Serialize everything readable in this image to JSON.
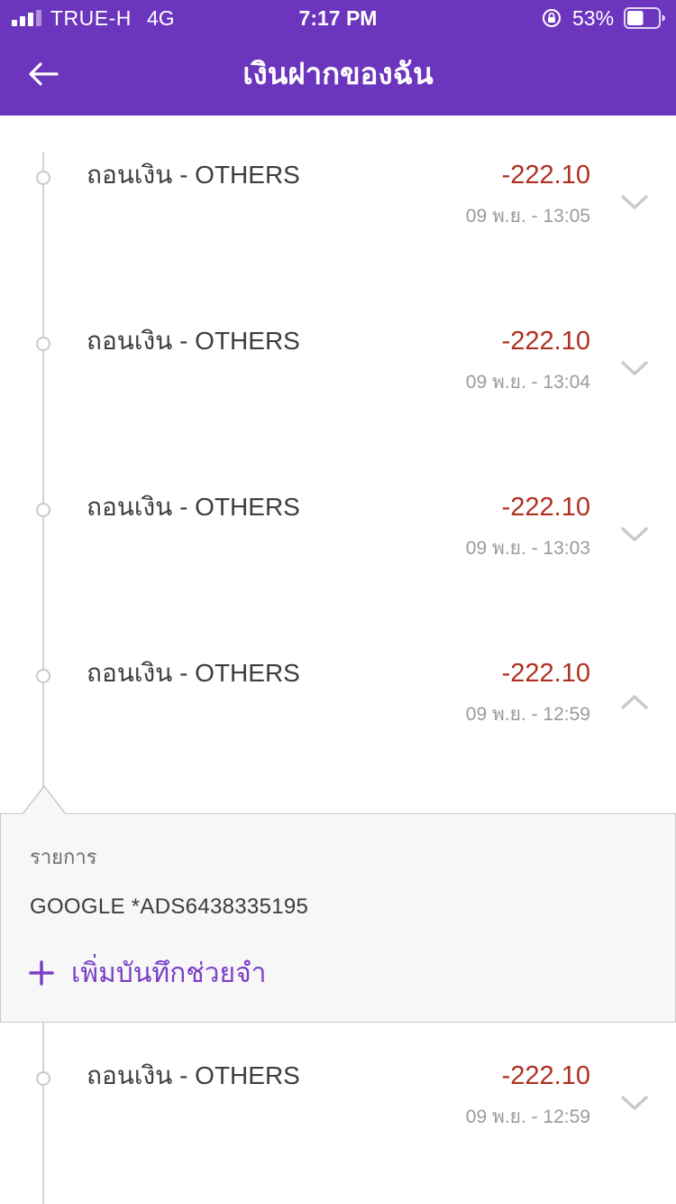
{
  "status_bar": {
    "carrier": "TRUE-H",
    "network": "4G",
    "time": "7:17 PM",
    "battery": "53%",
    "battery_level": 0.53
  },
  "header": {
    "title": "เงินฝากของฉัน",
    "back_icon": "arrow-left-icon"
  },
  "transactions": [
    {
      "title": "ถอนเงิน - OTHERS",
      "amount": "-222.10",
      "date": "09 พ.ย. - 13:05",
      "expanded": false
    },
    {
      "title": "ถอนเงิน - OTHERS",
      "amount": "-222.10",
      "date": "09 พ.ย. - 13:04",
      "expanded": false
    },
    {
      "title": "ถอนเงิน - OTHERS",
      "amount": "-222.10",
      "date": "09 พ.ย. - 13:03",
      "expanded": false
    },
    {
      "title": "ถอนเงิน - OTHERS",
      "amount": "-222.10",
      "date": "09 พ.ย. - 12:59",
      "expanded": true
    },
    {
      "title": "ถอนเงิน - OTHERS",
      "amount": "-222.10",
      "date": "09 พ.ย. - 12:59",
      "expanded": false
    }
  ],
  "details": {
    "label": "รายการ",
    "value": "GOOGLE *ADS6438335195",
    "add_note_label": "เพิ่มบันทึกช่วยจำ"
  },
  "colors": {
    "header": "#6c35bd",
    "amount": "#b0301f",
    "accent": "#7b3fc7"
  }
}
